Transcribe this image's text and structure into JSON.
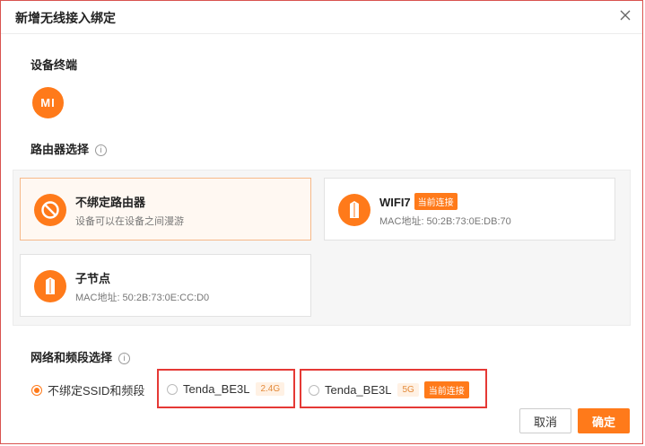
{
  "dialog": {
    "title": "新增无线接入绑定"
  },
  "device_section": {
    "title": "设备终端",
    "device_logo_text": "MI"
  },
  "router_section": {
    "title": "路由器选择",
    "cards": [
      {
        "title": "不绑定路由器",
        "subtitle": "设备可以在设备之间漫游"
      },
      {
        "title": "WIFI7",
        "tag": "当前连接",
        "subtitle": "MAC地址: 50:2B:73:0E:DB:70"
      },
      {
        "title": "子节点",
        "subtitle": "MAC地址: 50:2B:73:0E:CC:D0"
      }
    ]
  },
  "network_section": {
    "title": "网络和频段选择",
    "options": [
      {
        "label": "不绑定SSID和频段"
      },
      {
        "label": "Tenda_BE3L",
        "band": "2.4G"
      },
      {
        "label": "Tenda_BE3L",
        "band": "5G",
        "tag": "当前连接"
      }
    ]
  },
  "buttons": {
    "cancel": "取消",
    "confirm": "确定"
  },
  "colors": {
    "accent": "#ff7a1a",
    "highlight": "#e53935"
  }
}
